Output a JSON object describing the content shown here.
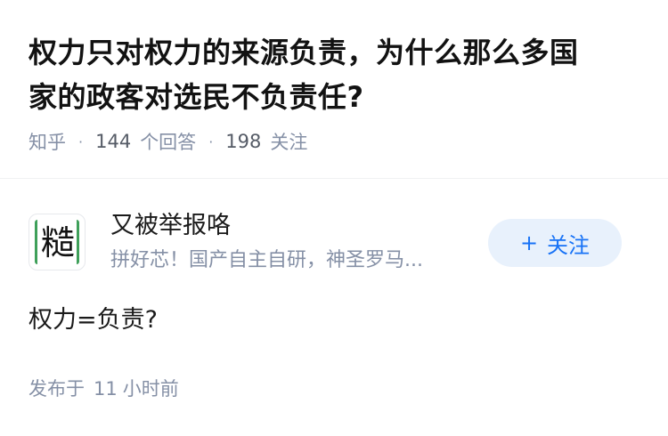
{
  "question": {
    "title_line1": "权力只对权力的来源负责，为什么那么多国",
    "title_line2": "家的政客对选民不负责任?",
    "source": "知乎",
    "answers_count": "144",
    "answers_label": "个回答",
    "followers_count": "198",
    "followers_label": "关注"
  },
  "author": {
    "avatar_char": "糙",
    "name": "又被举报咯",
    "bio": "拼好芯！国产自主自研，神圣罗马...",
    "follow_label": "关注",
    "follow_icon": "plus-icon"
  },
  "answer": {
    "content": "权力=负责?",
    "published_prefix": "发布于",
    "published_num": "11",
    "published_suffix": "小时前"
  },
  "colors": {
    "accent": "#1772f6",
    "follow_bg": "#e8f1fc",
    "meta_gray": "#8590a6",
    "avatar_frame": "#3fa05a"
  }
}
